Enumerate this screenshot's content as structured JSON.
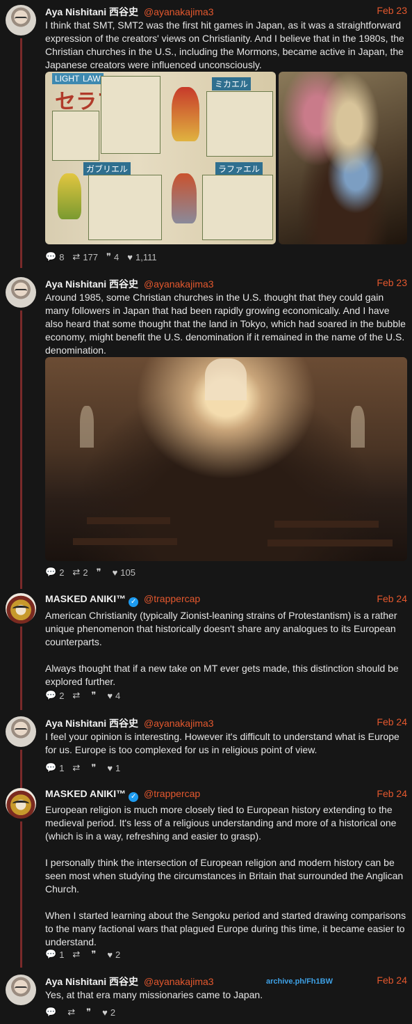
{
  "tweets": [
    {
      "name": "Aya Nishitani 西谷史",
      "handle": "@ayanakajima3",
      "verified": false,
      "date": "Feb 23",
      "text": "I think that SMT, SMT2 was the first hit games in Japan, as it was a straightforward expression of the creators' views on Christianity. And I believe that in the 1980s, the Christian churches in the U.S., including the Mormons, became active in Japan, the Japanese creators were influenced unconsciously.",
      "stats": {
        "replies": "8",
        "retweets": "177",
        "quotes": "4",
        "likes": "1,111"
      }
    },
    {
      "name": "Aya Nishitani 西谷史",
      "handle": "@ayanakajima3",
      "verified": false,
      "date": "Feb 23",
      "text": "Around 1985, some Christian churches in the U.S. thought that they could gain many followers in Japan that had been rapidly growing economically. And I have also heard that some thought that the land in Tokyo, which had soared in the bubble economy, might benefit the U.S. denomination if it remained in the name of the U.S. denomination.",
      "stats": {
        "replies": "2",
        "retweets": "2",
        "quotes": "",
        "likes": "105"
      }
    },
    {
      "name": "MASKED ANIKI™",
      "handle": "@trappercap",
      "verified": true,
      "date": "Feb 24",
      "text": "American Christianity (typically Zionist-leaning strains of Protestantism) is a rather unique phenomenon that historically doesn't share any analogues to its European counterparts.\n\nAlways thought that if a new take on MT ever gets made, this distinction should be explored further.",
      "stats": {
        "replies": "2",
        "retweets": "",
        "quotes": "",
        "likes": "4"
      }
    },
    {
      "name": "Aya Nishitani 西谷史",
      "handle": "@ayanakajima3",
      "verified": false,
      "date": "Feb 24",
      "text": "I feel your opinion is interesting. However it's difficult to understand what is Europe for us. Europe is too complexed for us in religious point of view.",
      "stats": {
        "replies": "1",
        "retweets": "",
        "quotes": "",
        "likes": "1"
      }
    },
    {
      "name": "MASKED ANIKI™",
      "handle": "@trappercap",
      "verified": true,
      "date": "Feb 24",
      "text": "European religion is much more closely tied to European history extending to the medieval period. It's less of a religious understanding and more of a historical one (which is in a way, refreshing and easier to grasp).\n\nI personally think the intersection of European religion and modern history can be seen most when studying the circumstances in Britain that surrounded the Anglican Church.\n\nWhen I started learning about the Sengoku period and started drawing comparisons to the many factional wars that plagued Europe during this time, it became easier to understand.",
      "stats": {
        "replies": "1",
        "retweets": "",
        "quotes": "",
        "likes": "2"
      }
    },
    {
      "name": "Aya Nishitani 西谷史",
      "handle": "@ayanakajima3",
      "verified": false,
      "date": "Feb 24",
      "text": "Yes, at that era many missionaries came to Japan.",
      "stats": {
        "replies": "",
        "retweets": "",
        "quotes": "",
        "likes": "2"
      }
    }
  ],
  "magazine": {
    "tag_light": "LIGHT",
    "tag_law": "LAW",
    "seraph": "セラフ",
    "michael": "ミカエル",
    "gabriel": "ガブリエル",
    "raphael": "ラファエル"
  },
  "watermark": "archive.ph/Fh1BW",
  "icons": {
    "reply": "reply-icon",
    "retweet": "retweet-icon",
    "quote": "quote-icon",
    "like": "like-icon"
  },
  "colors": {
    "background": "#161616",
    "accent": "#e4582e",
    "thread_line": "#7a2a2a",
    "verified": "#1d9bf0",
    "watermark": "#3ea1e6"
  }
}
